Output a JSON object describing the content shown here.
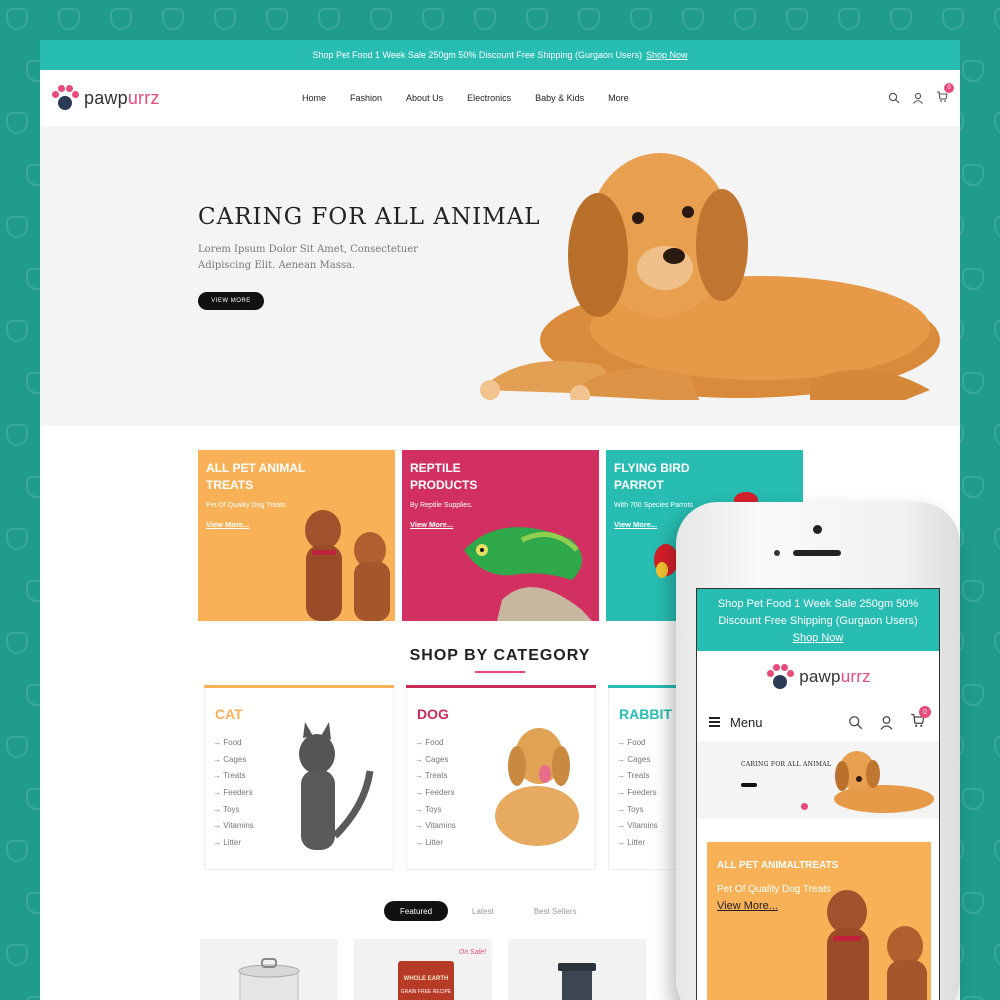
{
  "announcement": {
    "text": "Shop Pet Food 1 Week Sale 250gm 50% Discount Free Shipping (Gurgaon Users)",
    "link": "Shop Now"
  },
  "brand": {
    "part1": "pawp",
    "part2": "urrz"
  },
  "nav": {
    "items": [
      "Home",
      "Fashion",
      "About Us",
      "Electronics",
      "Baby & Kids",
      "More"
    ],
    "cart_count": "0"
  },
  "hero": {
    "title": "CARING FOR ALL ANIMAL",
    "subtitle": "Lorem Ipsum Dolor Sit Amet, Consectetuer Adipiscing Elit. Aenean Massa.",
    "button": "VIEW MORE"
  },
  "banners": [
    {
      "title": "ALL PET ANIMAL TREATS",
      "subtitle": "Pet Of Quality Dog Treats",
      "link": "View More...",
      "color": "#f9b157"
    },
    {
      "title": "REPTILE PRODUCTS",
      "subtitle": "By Reptile Supplies.",
      "link": "View More...",
      "color": "#d23060"
    },
    {
      "title": "FLYING BIRD PARROT",
      "subtitle": "With 700 Species Parrots",
      "link": "View More...",
      "color": "#27bdb2"
    }
  ],
  "shop_by_category": {
    "title": "SHOP BY CATEGORY",
    "categories": [
      {
        "name": "CAT",
        "color": "#f9b157",
        "items": [
          "Food",
          "Cages",
          "Treats",
          "Feeders",
          "Toys",
          "Vitamins",
          "Litter"
        ]
      },
      {
        "name": "DOG",
        "color": "#c82c58",
        "items": [
          "Food",
          "Cages",
          "Treats",
          "Feeders",
          "Toys",
          "Vitamins",
          "Litter"
        ]
      },
      {
        "name": "RABBIT",
        "color": "#27bdb2",
        "items": [
          "Food",
          "Cages",
          "Treats",
          "Feeders",
          "Toys",
          "Vitamins",
          "Litter"
        ]
      }
    ]
  },
  "product_tabs": [
    "Featured",
    "Latest",
    "Best Sellers"
  ],
  "products": {
    "sale_label": "On Sale!",
    "bag_brand": "WHOLE EARTH",
    "bag_note": "GRAIN FREE RECIPE"
  },
  "mobile": {
    "announcement": "Shop Pet Food 1 Week Sale 250gm 50% Discount Free Shipping (Gurgaon Users)",
    "announcement_link": "Shop Now",
    "menu_label": "Menu",
    "cart_count": "0",
    "hero_title": "CARING FOR ALL ANIMAL",
    "card_title": "ALL PET ANIMALTREATS",
    "card_subtitle": "Pet Of Quality Dog Treats",
    "card_link": "View More..."
  }
}
